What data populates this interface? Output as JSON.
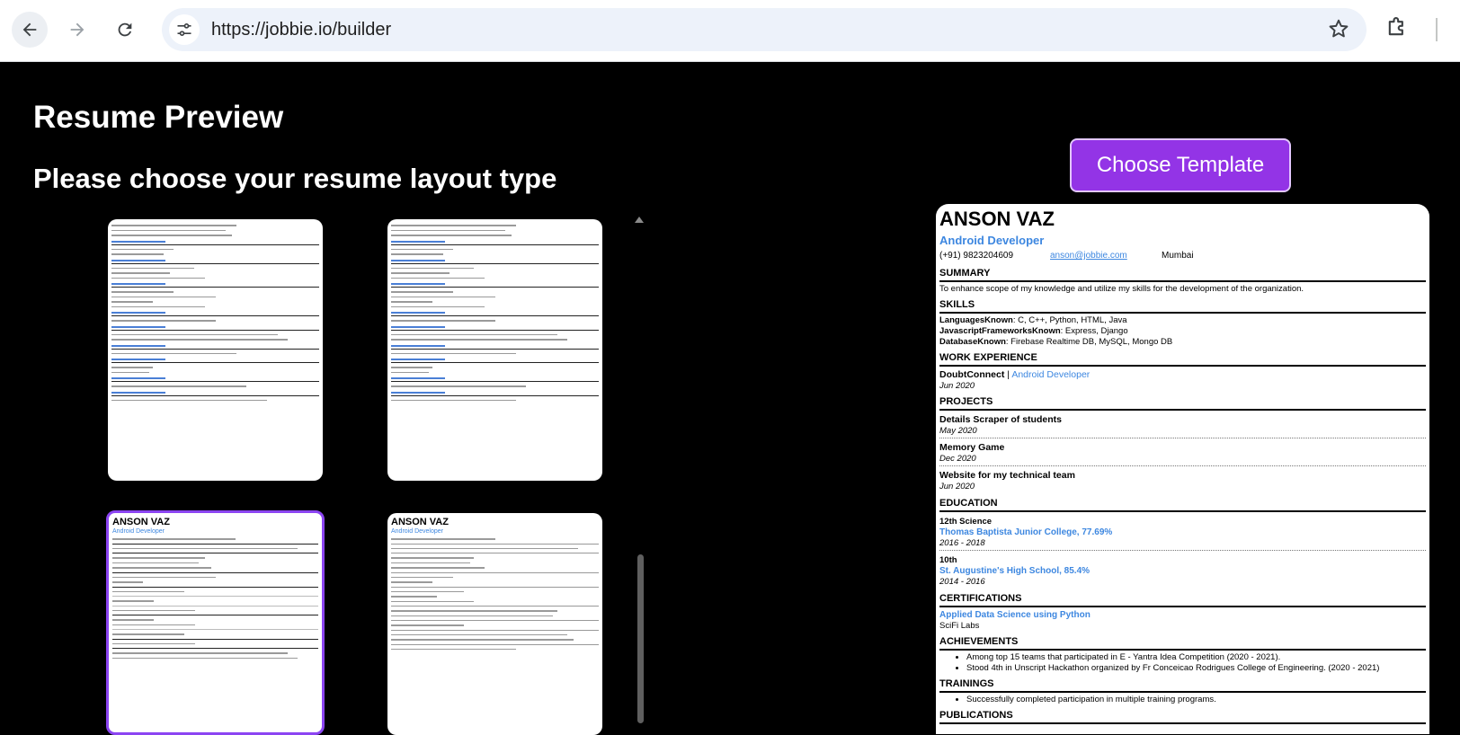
{
  "browser": {
    "url": "https://jobbie.io/builder",
    "back_icon": "arrow-left",
    "forward_icon": "arrow-right",
    "reload_icon": "reload",
    "site_info_icon": "tune",
    "bookmark_icon": "star",
    "extensions_icon": "puzzle"
  },
  "page": {
    "title": "Resume Preview",
    "subtitle": "Please choose your resume layout type",
    "choose_button": "Choose Template",
    "accent_color": "#9334e6"
  },
  "templates": [
    {
      "name_text": "",
      "selected": false
    },
    {
      "name_text": "",
      "selected": false
    },
    {
      "name_text": "ANSON VAZ",
      "role_text": "Android Developer",
      "selected": true
    },
    {
      "name_text": "ANSON VAZ",
      "role_text": "Android Developer",
      "selected": false
    }
  ],
  "resume": {
    "name": "ANSON VAZ",
    "role": "Android Developer",
    "phone": "(+91) 9823204609",
    "email": "anson@jobbie.com",
    "location": "Mumbai",
    "summary_heading": "SUMMARY",
    "summary": "To enhance scope of my knowledge and utilize my skills for the development of the organization.",
    "skills_heading": "SKILLS",
    "skills": [
      {
        "label": "LanguagesKnown",
        "value": ": C, C++, Python, HTML, Java"
      },
      {
        "label": "JavascriptFrameworksKnown",
        "value": ": Express, Django"
      },
      {
        "label": "DatabaseKnown",
        "value": ": Firebase Realtime DB, MySQL, Mongo DB"
      }
    ],
    "work_heading": "WORK EXPERIENCE",
    "work": {
      "company": "DoubtConnect",
      "separator": " | ",
      "position": "Android Developer",
      "date": "Jun 2020"
    },
    "projects_heading": "PROJECTS",
    "projects": [
      {
        "title": "Details Scraper of students",
        "date": "May 2020"
      },
      {
        "title": "Memory Game",
        "date": "Dec 2020"
      },
      {
        "title": "Website for my technical team",
        "date": "Jun 2020"
      }
    ],
    "education_heading": "EDUCATION",
    "education": [
      {
        "level": "12th Science",
        "school": "Thomas Baptista Junior College, 77.69%",
        "years": "2016 - 2018"
      },
      {
        "level": "10th",
        "school": "St. Augustine's High School, 85.4%",
        "years": "2014 - 2016"
      }
    ],
    "certifications_heading": "CERTIFICATIONS",
    "certification": {
      "title": "Applied Data Science using Python",
      "issuer": "SciFi Labs"
    },
    "achievements_heading": "ACHIEVEMENTS",
    "achievements": [
      "Among top 15 teams that participated in E - Yantra Idea Competition (2020 - 2021).",
      "Stood 4th in Unscript Hackathon organized by Fr Conceicao Rodrigues College of Engineering. (2020 - 2021)"
    ],
    "trainings_heading": "TRAININGS",
    "trainings": [
      "Successfully completed participation in multiple training programs."
    ],
    "publications_heading": "PUBLICATIONS"
  }
}
